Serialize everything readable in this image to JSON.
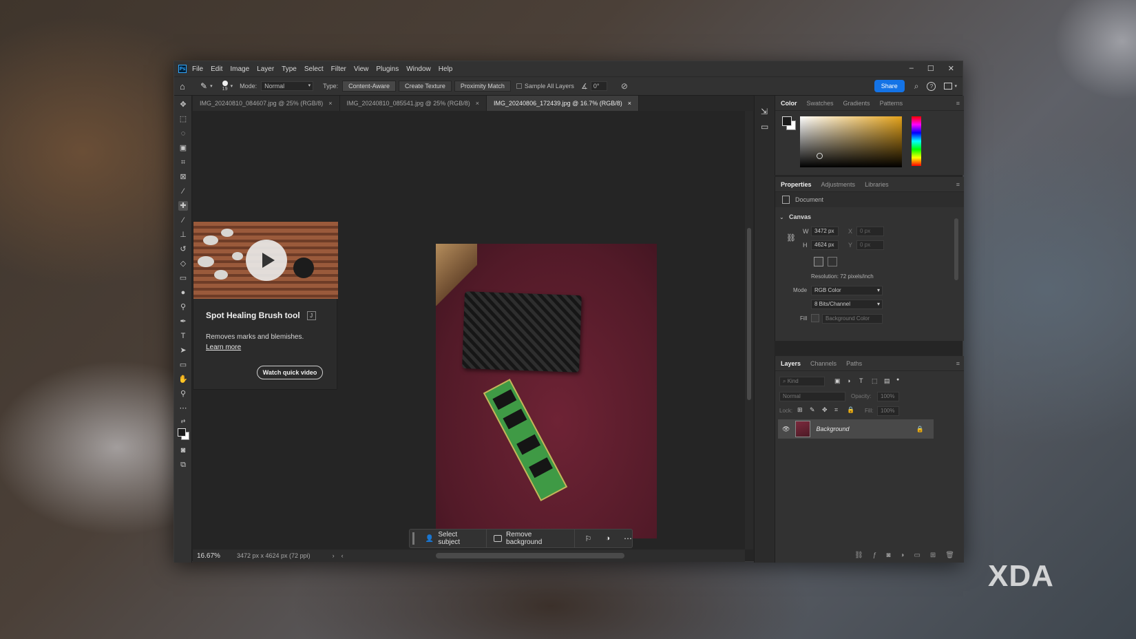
{
  "app": {
    "logo": "Ps"
  },
  "menu": [
    "File",
    "Edit",
    "Image",
    "Layer",
    "Type",
    "Select",
    "Filter",
    "View",
    "Plugins",
    "Window",
    "Help"
  ],
  "options": {
    "brush_size": "19",
    "mode_label": "Mode:",
    "mode_value": "Normal",
    "type_label": "Type:",
    "type_options": [
      "Content-Aware",
      "Create Texture",
      "Proximity Match"
    ],
    "sample_all": "Sample All Layers",
    "angle": "0°",
    "share": "Share"
  },
  "tabs": [
    {
      "label": "IMG_20240810_084607.jpg @ 25% (RGB/8)"
    },
    {
      "label": "IMG_20240810_085541.jpg @ 25% (RGB/8)"
    },
    {
      "label": "IMG_20240806_172439.jpg @ 16.7% (RGB/8)"
    }
  ],
  "tip": {
    "title": "Spot Healing Brush tool",
    "shortcut": "J",
    "desc": "Removes marks and blemishes.",
    "learn_more": "Learn more",
    "watch": "Watch quick video"
  },
  "context_bar": {
    "select_subject": "Select subject",
    "remove_background": "Remove background"
  },
  "status": {
    "zoom": "16.67%",
    "doc_info": "3472 px x 4624 px (72 ppi)"
  },
  "color_panel": {
    "tabs": [
      "Color",
      "Swatches",
      "Gradients",
      "Patterns"
    ]
  },
  "properties": {
    "tabs": [
      "Properties",
      "Adjustments",
      "Libraries"
    ],
    "document": "Document",
    "canvas": "Canvas",
    "w_label": "W",
    "w": "3472 px",
    "h_label": "H",
    "h": "4624 px",
    "x_label": "X",
    "x": "0 px",
    "y_label": "Y",
    "y": "0 px",
    "resolution": "Resolution: 72 pixels/inch",
    "mode_label": "Mode",
    "mode": "RGB Color",
    "depth": "8 Bits/Channel",
    "fill_label": "Fill",
    "fill": "Background Color"
  },
  "layers": {
    "tabs": [
      "Layers",
      "Channels",
      "Paths"
    ],
    "kind": "Kind",
    "blend": "Normal",
    "opacity_label": "Opacity:",
    "opacity": "100%",
    "lock_label": "Lock:",
    "fill_label": "Fill:",
    "fill": "100%",
    "layer_name": "Background"
  },
  "watermark": "XDA"
}
